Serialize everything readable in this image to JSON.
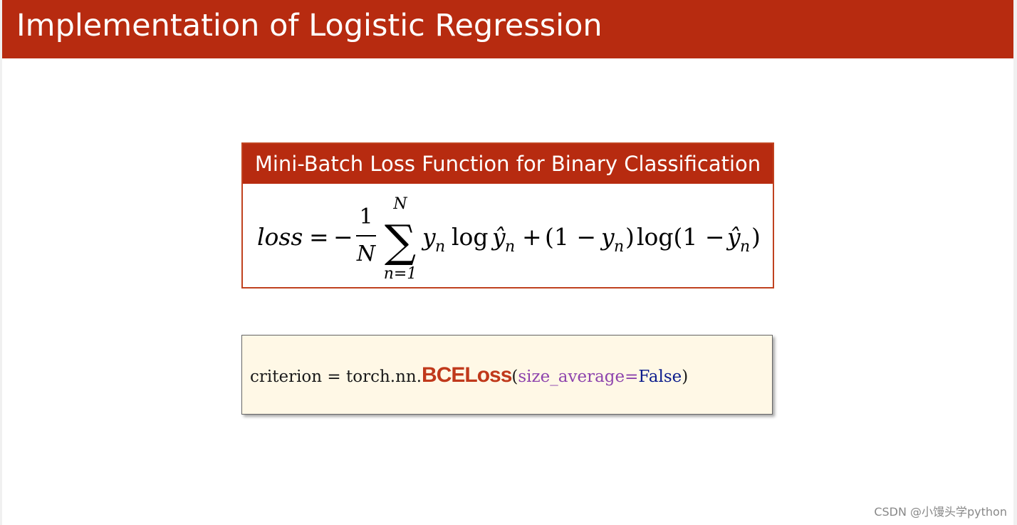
{
  "slide": {
    "title": "Implementation of Logistic Regression"
  },
  "formula_box": {
    "header": "Mini-Batch Loss Function for Binary Classification",
    "formula": {
      "lhs": "loss",
      "equals": "=",
      "minus": "−",
      "fraction_numerator": "1",
      "fraction_denominator": "N",
      "sum_symbol": "∑",
      "sum_upper": "N",
      "sum_lower": "n=1",
      "term1": "y",
      "term1_sub": "n",
      "log1": "log",
      "yhat1": "ŷ",
      "yhat1_sub": "n",
      "plus": "+",
      "paren_open": "(1 −",
      "term2": "y",
      "term2_sub": "n",
      "paren_close": ")",
      "log2": "log(1 −",
      "yhat2": "ŷ",
      "yhat2_sub": "n",
      "final_paren": ")"
    }
  },
  "code_box": {
    "prefix": "criterion = torch.nn.",
    "class_name": "BCELoss",
    "open_paren": "(",
    "kwarg": "size_average=",
    "value": "False",
    "close_paren": ")"
  },
  "watermark": "CSDN @小馒头学python",
  "colors": {
    "title_bar": "#b72b10",
    "box_border": "#c0421f",
    "code_bg": "#fff8e6",
    "bce_red": "#c0391b",
    "kwarg_purple": "#8e44ad",
    "false_blue": "#0b1c8c"
  }
}
